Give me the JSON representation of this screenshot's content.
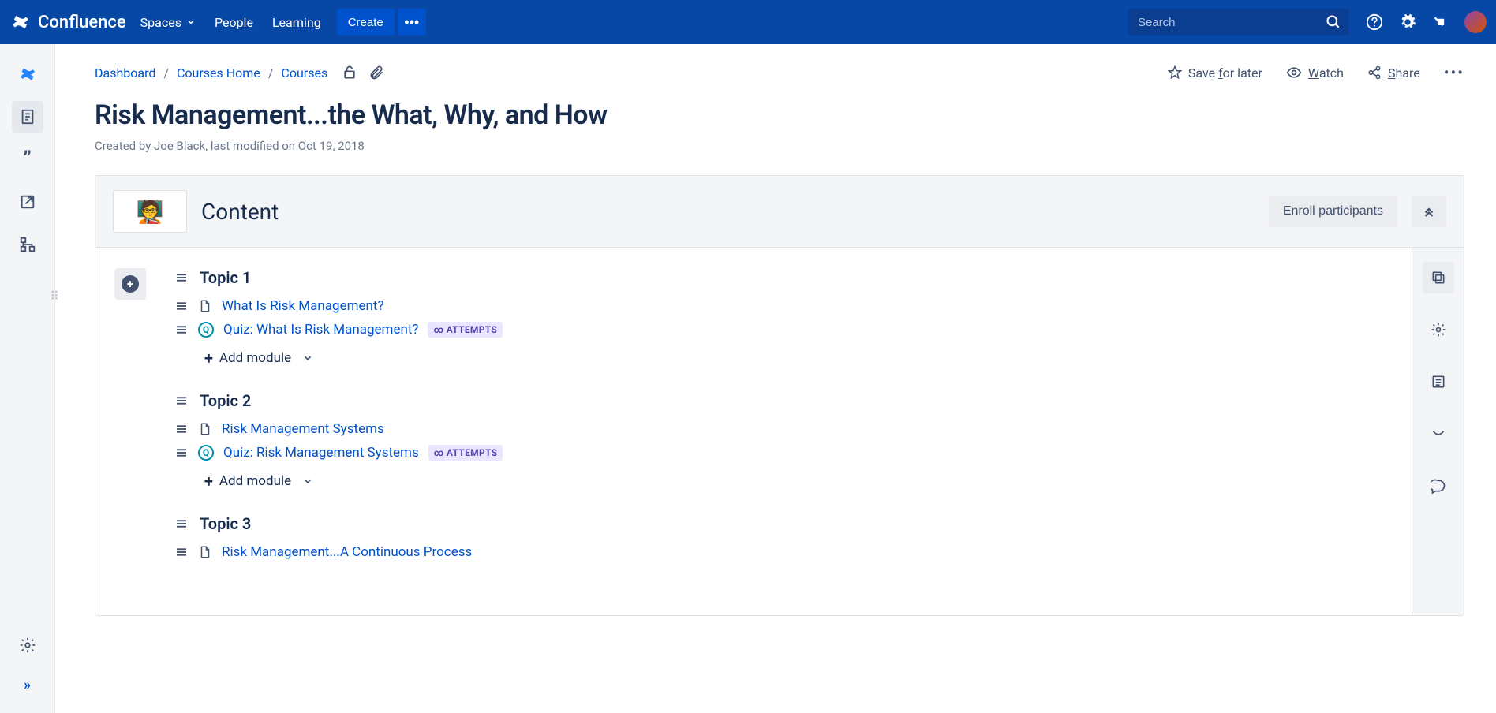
{
  "brand": "Confluence",
  "nav": {
    "spaces": "Spaces",
    "people": "People",
    "learning": "Learning"
  },
  "create_label": "Create",
  "search": {
    "placeholder": "Search"
  },
  "breadcrumb": {
    "dashboard": "Dashboard",
    "courses_home": "Courses Home",
    "courses": "Courses"
  },
  "page_actions": {
    "save": "Save for later",
    "save_accel": "f",
    "watch": "Watch",
    "watch_accel": "W",
    "share": "Share",
    "share_accel": "S"
  },
  "page_title": "Risk Management...the What, Why, and How",
  "page_sub": "Created by Joe Black, last modified on Oct 19, 2018",
  "panel": {
    "title": "Content",
    "enroll_label": "Enroll participants"
  },
  "badge_text": "∞ ATTEMPTS",
  "add_module_label": "Add module",
  "topics": [
    {
      "title": "Topic 1",
      "modules": [
        {
          "kind": "doc",
          "label": "What Is Risk Management?"
        },
        {
          "kind": "quiz",
          "label": "Quiz: What Is Risk Management?",
          "badge": true
        }
      ],
      "show_add": true
    },
    {
      "title": "Topic 2",
      "modules": [
        {
          "kind": "doc",
          "label": "Risk Management Systems"
        },
        {
          "kind": "quiz",
          "label": "Quiz: Risk Management Systems",
          "badge": true
        }
      ],
      "show_add": true
    },
    {
      "title": "Topic 3",
      "modules": [
        {
          "kind": "doc",
          "label": "Risk Management...A Continuous Process"
        }
      ],
      "show_add": false
    }
  ]
}
